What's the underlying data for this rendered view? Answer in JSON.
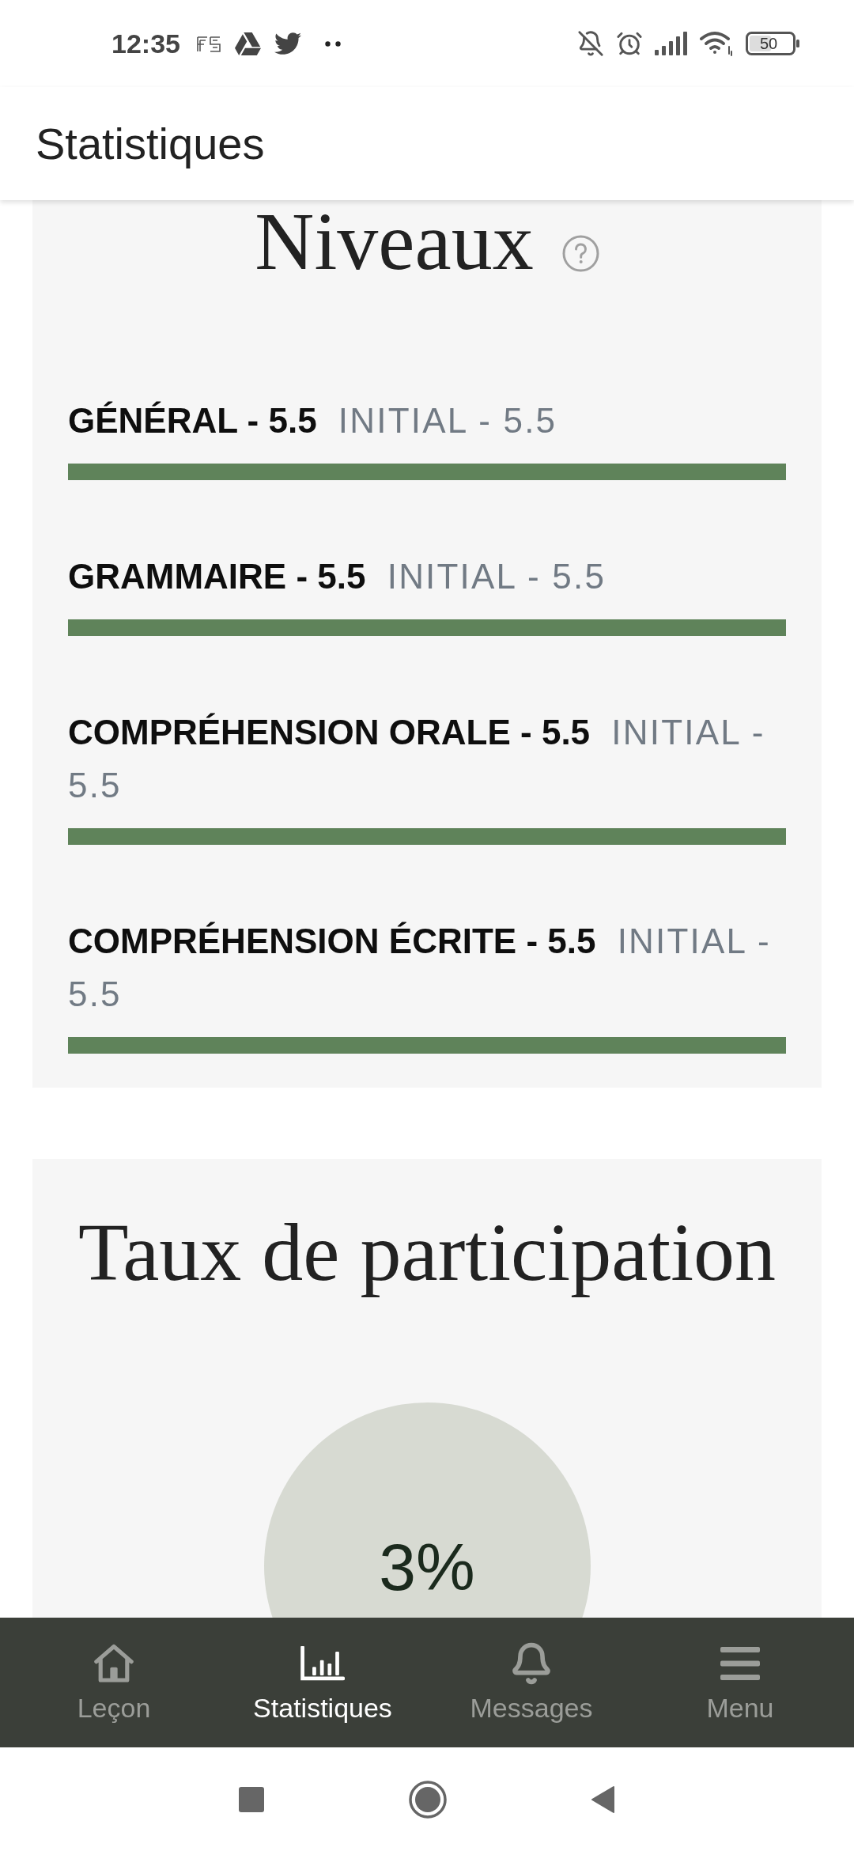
{
  "status_bar": {
    "time": "12:35",
    "battery": "50"
  },
  "app_bar": {
    "title": "Statistiques"
  },
  "levels": {
    "title": "Niveaux",
    "items": [
      {
        "label": "GÉNÉRAL - 5.5",
        "initial": "INITIAL - 5.5",
        "level": 1
      },
      {
        "label": "GRAMMAIRE - 5.5",
        "initial": "INITIAL - 5.5",
        "level": 1
      },
      {
        "label": "COMPRÉHENSION ORALE - 5.5",
        "initial": "INITIAL - 5.5",
        "level": 1
      },
      {
        "label": "COMPRÉHENSION ÉCRITE - 5.5",
        "initial": "INITIAL - 5.5",
        "level": 1
      }
    ]
  },
  "participation": {
    "title": "Taux de participation",
    "value": "3%"
  },
  "bottom_nav": [
    {
      "label": "Leçon",
      "selected": false
    },
    {
      "label": "Statistiques",
      "selected": true
    },
    {
      "label": "Messages",
      "selected": false
    },
    {
      "label": "Menu",
      "selected": false
    }
  ]
}
